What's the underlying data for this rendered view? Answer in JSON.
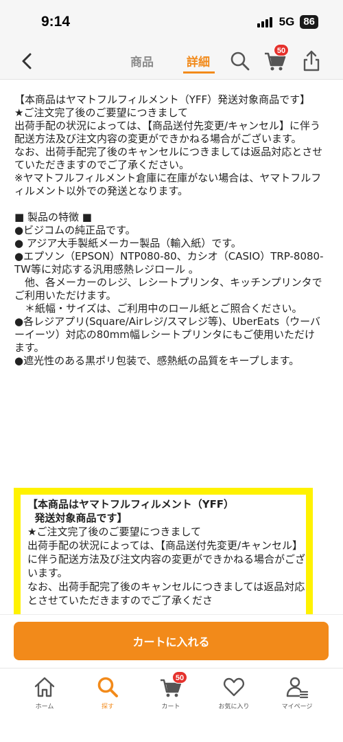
{
  "status_bar": {
    "time": "9:14",
    "network": "5G",
    "battery": "86"
  },
  "nav": {
    "tabs": [
      {
        "label": "商品",
        "active": false
      },
      {
        "label": "詳細",
        "active": true
      }
    ],
    "cart_badge": "50",
    "accent_color": "#f28a1a"
  },
  "description": {
    "text": "【本商品はヤマトフルフィルメント（YFF）発送対象商品です】\n★ご注文完了後のご要望につきまして\n出荷手配の状況によっては、【商品送付先変更/キャンセル】に伴う配送方法及び注文内容の変更ができかねる場合がございます。\nなお、出荷手配完了後のキャンセルにつきましては返品対応とさせていただきますのでご了承ください。\n※ヤマトフルフィルメント倉庫に在庫がない場合は、ヤマトフルフィルメント以外での発送となります。\n\n■ 製品の特徴 ■\n●ビジコムの純正品です。\n● アジア大手製紙メーカー製品（輸入紙）です。\n●エプソン（EPSON）NTP080-80、カシオ（CASIO）TRP-8080-TW等に対応する汎用感熱レジロール 。\n　他、各メーカーのレジ、レシートプリンタ、キッチンプリンタでご利用いただけます。\n　＊紙幅・サイズは、ご利用中のロール紙とご照合ください。\n●各レジアプリ(Square/Airレジ/スマレジ等)、UberEats（ウーバーイーツ）対応の80mm幅レシートプリンタにもご使用いただけます。\n●遮光性のある黒ポリ包装で、感熱紙の品質をキープします。"
  },
  "yff_box": {
    "title": "【本商品はヤマトフルフィルメント（YFF）\n  発送対象商品です】",
    "body": "\n★ご注文完了後のご要望につきまして\n出荷手配の状況によっては、【商品送付先変更/キャンセル】に伴う配送方法及び注文内容の変更ができかねる場合がございます。\nなお、出荷手配完了後のキャンセルにつきましては返品対応とさせていただきますのでご了承くださ",
    "highlight_color": "#fff200"
  },
  "action": {
    "add_to_cart_label": "カートに入れる"
  },
  "tab_bar": {
    "items": [
      {
        "label": "ホーム",
        "icon": "home-icon",
        "active": false
      },
      {
        "label": "探す",
        "icon": "search-icon",
        "active": true
      },
      {
        "label": "カート",
        "icon": "cart-icon",
        "active": false,
        "badge": "50"
      },
      {
        "label": "お気に入り",
        "icon": "heart-icon",
        "active": false
      },
      {
        "label": "マイページ",
        "icon": "person-icon",
        "active": false
      }
    ]
  }
}
